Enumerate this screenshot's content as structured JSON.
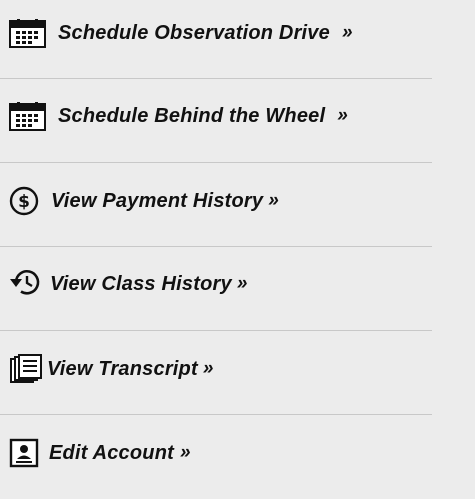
{
  "menu": {
    "items": [
      {
        "label": "Schedule Observation Drive",
        "suffix": "»",
        "icon": "calendar-icon"
      },
      {
        "label": "Schedule Behind the Wheel",
        "suffix": "»",
        "icon": "calendar-icon"
      },
      {
        "label": "View Payment History",
        "suffix": "»",
        "icon": "dollar-circle-icon"
      },
      {
        "label": "View Class History",
        "suffix": "»",
        "icon": "history-icon"
      },
      {
        "label": "View Transcript",
        "suffix": "»",
        "icon": "documents-icon"
      },
      {
        "label": "Edit Account",
        "suffix": "»",
        "icon": "account-card-icon"
      }
    ]
  },
  "colors": {
    "background": "#ececec",
    "text": "#111111",
    "divider": "#c8c8c8"
  }
}
